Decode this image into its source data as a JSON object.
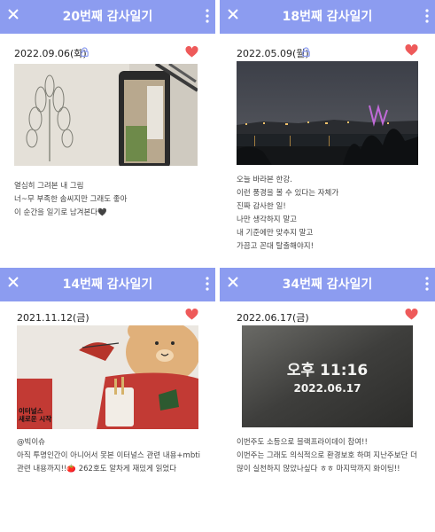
{
  "cards": [
    {
      "title": "20번째 감사일기",
      "date": "2022.09.06(화)",
      "locked": true,
      "liked": true,
      "text": "열심히 그려본 내 그림\n너~무 부족한 솜씨지만 그래도 좋아\n이 순간을 일기로 남겨본다🖤"
    },
    {
      "title": "18번째 감사일기",
      "date": "2022.05.09(월)",
      "locked": true,
      "liked": true,
      "text": "오늘 바라본 한강.\n이런 풍경을 볼 수 있다는 자체가\n진짜 감사한 일!\n나만 생각하지 말고\n내 기준에만 맞추지 말고\n가끔고 꼰대 탈출해야지!"
    },
    {
      "title": "14번째 감사일기",
      "date": "2021.11.12(금)",
      "locked": false,
      "liked": true,
      "photo_caption": "이터널스\n새로운 시작",
      "text": "@빅이슈\n아직 투명인간이 아니어서 못본 이터널스 관련 내용+mbti\n관련 내용까지!!🍅 262호도 알차게 재밌게 읽었다"
    },
    {
      "title": "34번째 감사일기",
      "date": "2022.06.17(금)",
      "locked": false,
      "liked": true,
      "photo_time": "오후 11:16",
      "photo_date": "2022.06.17",
      "text": "이번주도 소등으로 블랙프라이데이 참여!!\n이번주는 그래도 의식적으로 환경보호 하며 지난주보단 더\n많이 실천하지 않았나싶다 ㅎㅎ 마지막까지 화이팅!!"
    }
  ],
  "colors": {
    "header": "#8c9cf0",
    "heart": "#ee5a5a",
    "lock": "#8c9cf0"
  },
  "icons": {
    "close": "close-icon",
    "menu": "more-vertical-icon",
    "lock": "lock-icon",
    "heart": "heart-icon"
  }
}
